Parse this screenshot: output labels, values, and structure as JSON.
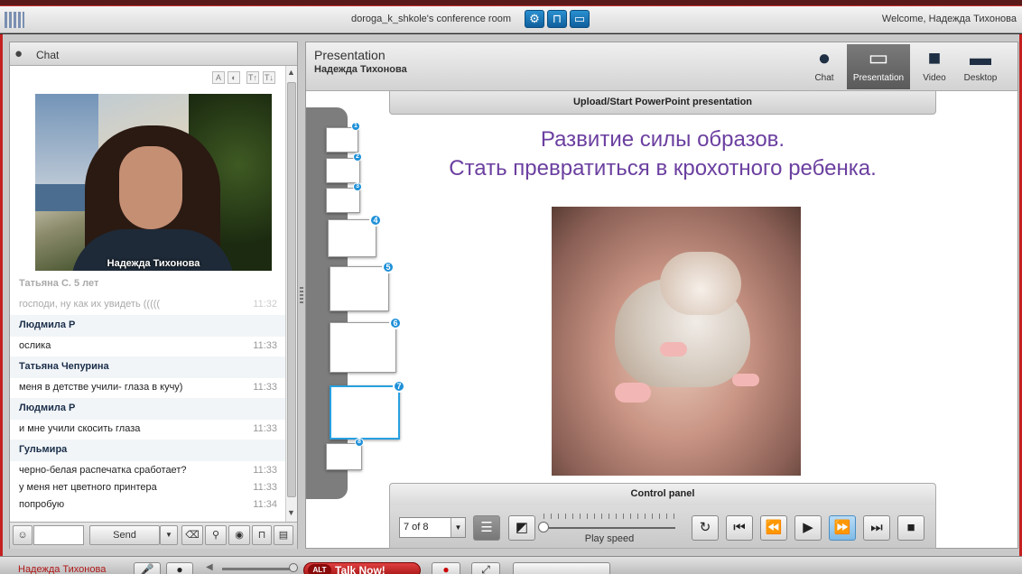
{
  "topbar": {
    "room_title": "doroga_k_shkole's conference room",
    "welcome": "Welcome, Надежда Тихонова",
    "buttons": [
      {
        "name": "settings-icon",
        "glyph": "⚙"
      },
      {
        "name": "lock-icon",
        "glyph": "🔓"
      },
      {
        "name": "screen-icon",
        "glyph": "▭"
      }
    ]
  },
  "chat": {
    "title": "Chat",
    "video_name": "Надежда Тихонова",
    "messages": [
      {
        "sender": "Татьяна С. 5 лет",
        "faded": true,
        "lines": [
          {
            "text": "господи, ну как их увидеть (((((",
            "time": "11:32"
          }
        ]
      },
      {
        "sender": "Людмила Р",
        "faded": false,
        "lines": [
          {
            "text": "ослика",
            "time": "11:33"
          }
        ]
      },
      {
        "sender": "Татьяна Чепурина",
        "faded": false,
        "lines": [
          {
            "text": "меня в детстве учили- глаза в кучу)",
            "time": "11:33"
          }
        ]
      },
      {
        "sender": "Людмила Р",
        "faded": false,
        "lines": [
          {
            "text": "и мне учили скосить глаза",
            "time": "11:33"
          }
        ]
      },
      {
        "sender": "Гульмира",
        "faded": false,
        "lines": [
          {
            "text": "черно-белая распечатка сработает?",
            "time": "11:33"
          },
          {
            "text": "у меня нет цветного принтера",
            "time": "11:33"
          },
          {
            "text": "попробую",
            "time": "11:34"
          }
        ]
      }
    ],
    "send_label": "Send",
    "input_value": ""
  },
  "presentation": {
    "title": "Presentation",
    "presenter": "Надежда Тихонова",
    "modes": [
      {
        "label": "Chat",
        "glyph": "💬",
        "active": false
      },
      {
        "label": "Presentation",
        "glyph": "▭",
        "active": true
      },
      {
        "label": "Video",
        "glyph": "🎥",
        "active": false
      },
      {
        "label": "Desktop",
        "glyph": "🖥",
        "active": false
      }
    ],
    "upload_label": "Upload/Start PowerPoint presentation",
    "slide_title_line1": "Развитие силы образов.",
    "slide_title_line2": "Стать превратиться в крохотного ребенка.",
    "thumbnails": [
      "1",
      "2",
      "3",
      "4",
      "5",
      "6",
      "7",
      "8"
    ],
    "selected_thumbnail": "7",
    "control_panel_title": "Control panel",
    "page_select": "7 of 8",
    "play_speed_label": "Play speed",
    "play_speed": 0.0
  },
  "bottombar": {
    "user": "Надежда Тихонова",
    "talk_label": "Talk Now!",
    "talk_badge": "ALT"
  },
  "colors": {
    "accent_blue": "#1e90d8",
    "slide_title": "#6b3fa0",
    "frame_red": "#c42020"
  }
}
